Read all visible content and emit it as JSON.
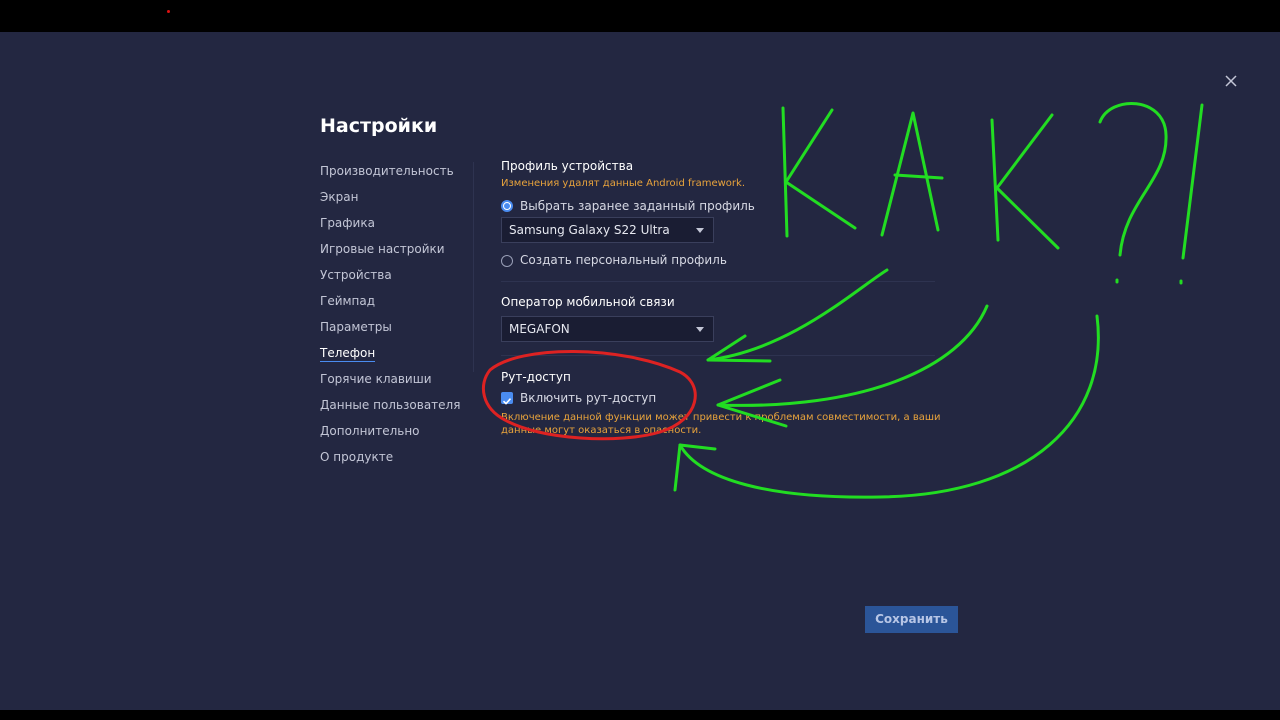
{
  "dialog": {
    "title": "Настройки",
    "close_icon": "close-icon"
  },
  "sidebar": {
    "items": [
      {
        "label": "Производительность",
        "active": false
      },
      {
        "label": "Экран",
        "active": false
      },
      {
        "label": "Графика",
        "active": false
      },
      {
        "label": "Игровые настройки",
        "active": false
      },
      {
        "label": "Устройства",
        "active": false
      },
      {
        "label": "Геймпад",
        "active": false
      },
      {
        "label": "Параметры",
        "active": false
      },
      {
        "label": "Телефон",
        "active": true
      },
      {
        "label": "Горячие клавиши",
        "active": false
      },
      {
        "label": "Данные пользователя",
        "active": false
      },
      {
        "label": "Дополнительно",
        "active": false
      },
      {
        "label": "О продукте",
        "active": false
      }
    ]
  },
  "device_profile": {
    "heading": "Профиль устройства",
    "warning": "Изменения удалят данные Android framework.",
    "option_preset": {
      "label": "Выбрать заранее заданный профиль",
      "selected": true
    },
    "preset_value": "Samsung Galaxy S22 Ultra",
    "option_custom": {
      "label": "Создать персональный профиль",
      "selected": false
    }
  },
  "operator": {
    "heading": "Оператор мобильной связи",
    "value": "MEGAFON"
  },
  "root": {
    "heading": "Рут-доступ",
    "checkbox_label": "Включить рут-доступ",
    "checked": true,
    "warning_line1": "Включение данной функции может привести к проблемам совместимости, а ваши",
    "warning_line2": "данные могут оказаться в опасности."
  },
  "footer": {
    "save_label": "Сохранить"
  },
  "annotation": {
    "text": "КАК?!",
    "ink_color": "#22dd22",
    "circle_color": "#dd2222"
  },
  "colors": {
    "background": "#232741",
    "accent": "#4a8cf0",
    "warning": "#e8a33c",
    "button": "#2b5598"
  }
}
